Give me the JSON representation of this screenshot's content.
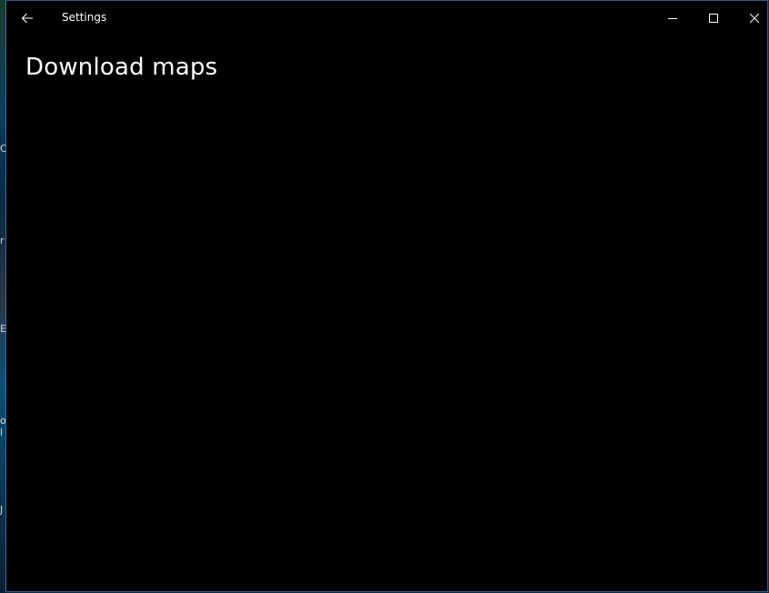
{
  "window": {
    "app_title": "Settings",
    "accent_color": "#1f5f9a",
    "background_color": "#000000"
  },
  "titlebar": {
    "back_icon": "arrow-left-icon",
    "minimize_icon": "minimize-icon",
    "maximize_icon": "maximize-icon",
    "close_icon": "close-icon"
  },
  "page": {
    "title": "Download maps"
  },
  "desktop": {
    "edge_glyphs": [
      "C",
      "r",
      "E",
      "o",
      "l",
      "J"
    ]
  }
}
